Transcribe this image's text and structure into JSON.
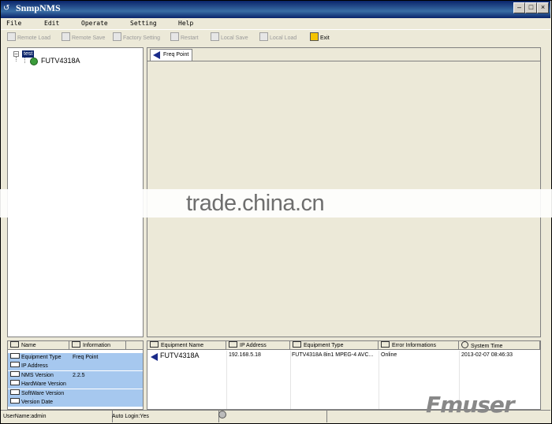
{
  "window": {
    "title": "SnmpNMS"
  },
  "menu": [
    "File",
    "Edit",
    "Operate",
    "Setting",
    "Help"
  ],
  "toolbar": [
    {
      "label": "Remote Load",
      "enabled": false,
      "icon": "remote-load-icon"
    },
    {
      "label": "Remote Save",
      "enabled": false,
      "icon": "remote-save-icon"
    },
    {
      "label": "Factory Setting",
      "enabled": false,
      "icon": "factory-setting-icon"
    },
    {
      "label": "Restart",
      "enabled": false,
      "icon": "restart-icon"
    },
    {
      "label": "Local Save",
      "enabled": false,
      "icon": "local-save-icon"
    },
    {
      "label": "Local Load",
      "enabled": false,
      "icon": "local-load-icon"
    },
    {
      "label": "Exit",
      "enabled": true,
      "icon": "exit-icon"
    }
  ],
  "tree": {
    "root": "test",
    "child": "FUTV4318A"
  },
  "tabs": [
    {
      "label": "Freq Point",
      "selected": true
    }
  ],
  "watermark": "trade.china.cn",
  "info_panel": {
    "headers": [
      "Name",
      "Information"
    ],
    "rows": [
      {
        "name": "Equipment Type",
        "value": "Freq Point"
      },
      {
        "name": "IP Address",
        "value": ""
      },
      {
        "name": "NMS Version",
        "value": "2.2.5"
      },
      {
        "name": "HardWare Version",
        "value": ""
      },
      {
        "name": "SoftWare Version",
        "value": ""
      },
      {
        "name": "Version Date",
        "value": ""
      }
    ]
  },
  "device_list": {
    "headers": [
      "Equipment Name",
      "IP Address",
      "Equipment Type",
      "Error Informations",
      "System Time"
    ],
    "rows": [
      {
        "name": "FUTV4318A",
        "ip": "192.168.5.18",
        "type": "FUTV4318A 8in1 MPEG-4 AVC...",
        "error": "Online",
        "time": "2013-02-07 08:46:33"
      }
    ]
  },
  "status": {
    "user": "UserName:admin",
    "login": "Auto Login:Yes"
  },
  "logo": "Fmuser",
  "colors": {
    "title_bar": "#0a246a",
    "selection": "#0a246a",
    "info_highlight": "#a6c8ef"
  }
}
